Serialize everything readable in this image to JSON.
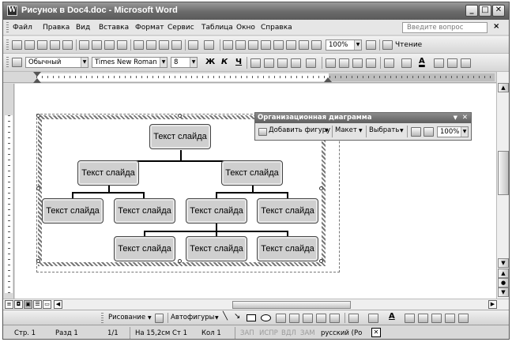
{
  "window": {
    "title": "Рисунок в Doc4.doc - Microsoft Word",
    "app_icon": "W",
    "controls": {
      "minimize": "_",
      "maximize": "□",
      "close": "✕"
    }
  },
  "menu": {
    "items": [
      "Файл",
      "Правка",
      "Вид",
      "Вставка",
      "Формат",
      "Сервис",
      "Таблица",
      "Окно",
      "Справка"
    ],
    "ask_placeholder": "Введите вопрос",
    "close": "×"
  },
  "standard_toolbar": {
    "zoom": "100%",
    "reading_label": "Чтение"
  },
  "format_toolbar": {
    "style": "Обычный",
    "font": "Times New Roman",
    "size": "8",
    "bold": "Ж",
    "italic": "К",
    "underline": "Ч"
  },
  "org_toolbar": {
    "title": "Организационная диаграмма",
    "add_shape": "Добавить фигуру",
    "layout": "Макет",
    "select": "Выбрать",
    "zoom": "100%"
  },
  "org_chart": {
    "nodes": [
      "Текст слайда",
      "Текст слайда",
      "Текст слайда",
      "Текст слайда",
      "Текст слайда",
      "Текст слайда",
      "Текст слайда",
      "Текст слайда",
      "Текст слайда",
      "Текст слайда"
    ]
  },
  "drawing_toolbar": {
    "drawing_menu": "Рисование",
    "autoshapes_menu": "Автофигуры"
  },
  "status_bar": {
    "page": "Стр. 1",
    "section": "Разд 1",
    "pages": "1/1",
    "at": "На 15,2см",
    "line": "Ст 1",
    "col": "Кол 1",
    "rec": "ЗАП",
    "trk": "ИСПР",
    "ext": "ВДЛ",
    "ovr": "ЗАМ",
    "lang": "русский (Ро"
  }
}
